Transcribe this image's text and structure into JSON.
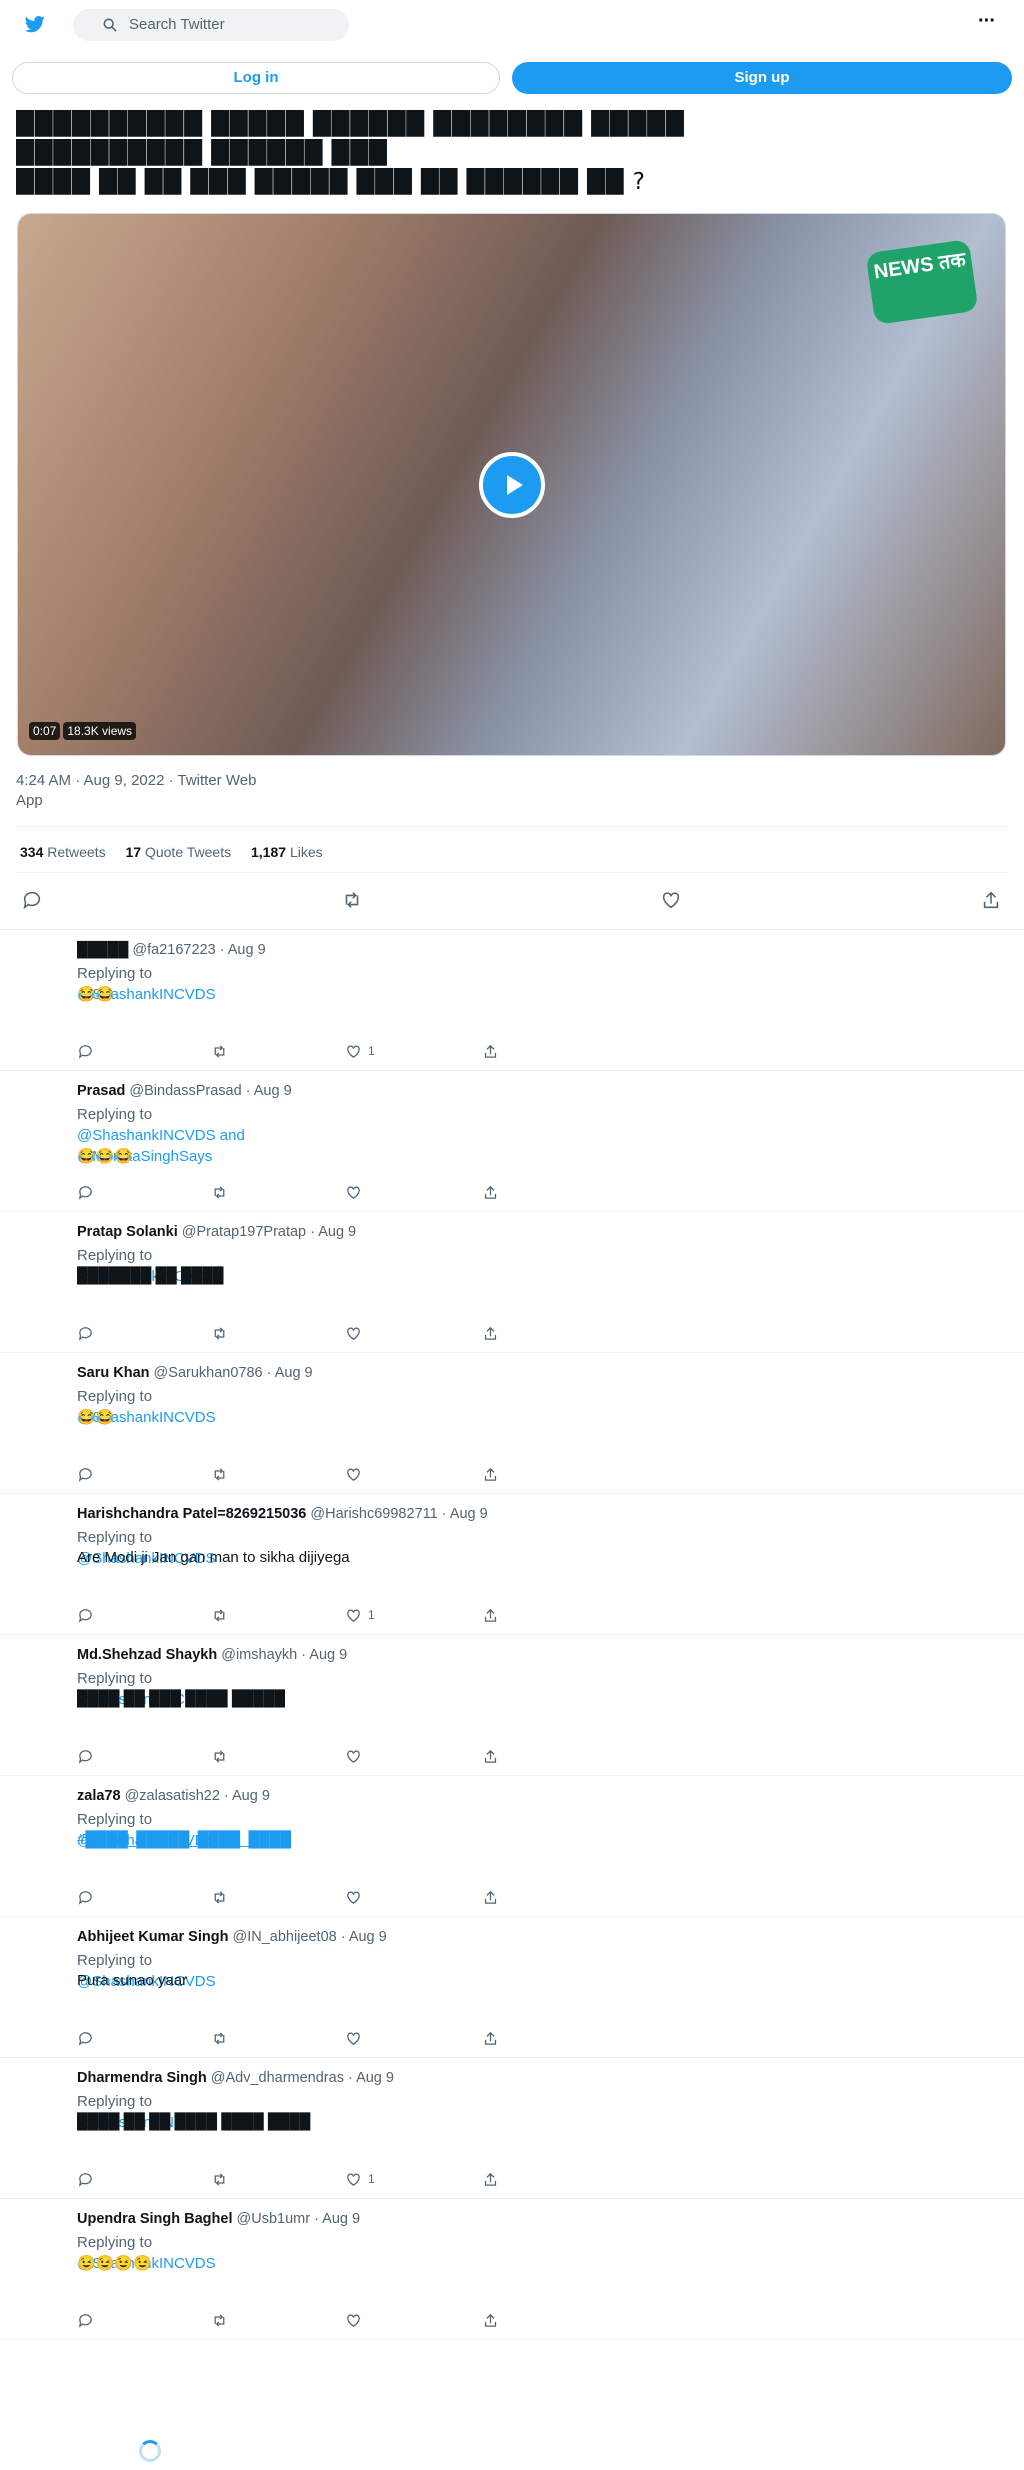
{
  "nav": {
    "search_placeholder": "Search Twitter",
    "more": "···"
  },
  "auth": {
    "login": "Log in",
    "signup": "Sign up"
  },
  "tweet": {
    "text_lines": [
      "██████████ █████ ██████ ████████ █████",
      "██████████ ██████ ███",
      "████ ██ ██ ███ █████ ███ ██ ██████ ██ ?"
    ],
    "video": {
      "duration": "0:07",
      "views": "18.3K views",
      "watermark": "NEWS तक"
    },
    "time": "4:24 AM · Aug 9, 2022 · Twitter Web App",
    "stats": [
      {
        "count": "334",
        "label": "Retweets"
      },
      {
        "count": "17",
        "label": "Quote Tweets"
      },
      {
        "count": "1,187",
        "label": "Likes"
      }
    ]
  },
  "replies": [
    {
      "name": "█████",
      "handle": "@fa2167223",
      "date": "Aug 9",
      "replying_prefix": "Replying to",
      "mentions": "@ShashankINCVDS",
      "mentions2": "",
      "body": "😂😂",
      "body_link": false,
      "likes": "1"
    },
    {
      "name": "Prasad",
      "handle": "@BindassPrasad",
      "date": "Aug 9",
      "replying_prefix": "Replying to",
      "mentions": "@ShashankINCVDS and",
      "mentions2": "@MonikaSinghSays",
      "body": "😂😂😂",
      "body_link": false,
      "likes": ""
    },
    {
      "name": "Pratap Solanki",
      "handle": "@Pratap197Pratap",
      "date": "Aug 9",
      "replying_prefix": "Replying to",
      "mentions": "@ShashankINCVDS",
      "mentions2": "",
      "body": "███████ ██ ████",
      "body_link": false,
      "likes": ""
    },
    {
      "name": "Saru Khan",
      "handle": "@Sarukhan0786",
      "date": "Aug 9",
      "replying_prefix": "Replying to",
      "mentions": "@ShashankINCVDS",
      "mentions2": "",
      "body": "  😂😂",
      "body_link": false,
      "likes": ""
    },
    {
      "name": "Harishchandra Patel=8269215036",
      "handle": "@Harishc69982711",
      "date": "Aug 9",
      "replying_prefix": "Replying to",
      "mentions": "@ShashankINCVDS",
      "mentions2": "",
      "body": "Are Modi ji Jan gan man to sikha dijiyega",
      "body_link": false,
      "likes": "1"
    },
    {
      "name": "Md.Shehzad Shaykh",
      "handle": "@imshaykh",
      "date": "Aug 9",
      "replying_prefix": "Replying to",
      "mentions": "@ShashankINCVDS",
      "mentions2": "",
      "body": "████ ██ ███ ████ █████",
      "body_link": false,
      "likes": ""
    },
    {
      "name": "zala78",
      "handle": "@zalasatish22",
      "date": "Aug 9",
      "replying_prefix": "Replying to",
      "mentions": "@ShashankINCVDS",
      "mentions2": "",
      "body": "#████_█████_████_████",
      "body_link": true,
      "likes": ""
    },
    {
      "name": "Abhijeet Kumar Singh",
      "handle": "@IN_abhijeet08",
      "date": "Aug 9",
      "replying_prefix": "Replying to",
      "mentions": "@ShashankINCVDS",
      "mentions2": "",
      "body": "Pura sunao yaar",
      "body_link": false,
      "likes": ""
    },
    {
      "name": "Dharmendra Singh",
      "handle": "@Adv_dharmendras",
      "date": "Aug 9",
      "replying_prefix": "Replying to",
      "mentions": "@ShashankINCVDS",
      "mentions2": "",
      "body": "████ ██ ██ ████ ████ ████",
      "body_link": false,
      "likes": "1"
    },
    {
      "name": "Upendra Singh Baghel",
      "handle": "@Usb1umr",
      "date": "Aug 9",
      "replying_prefix": "Replying to",
      "mentions": "@ShashankINCVDS",
      "mentions2": "",
      "body": "😉😉😉😉",
      "body_link": false,
      "likes": ""
    }
  ]
}
